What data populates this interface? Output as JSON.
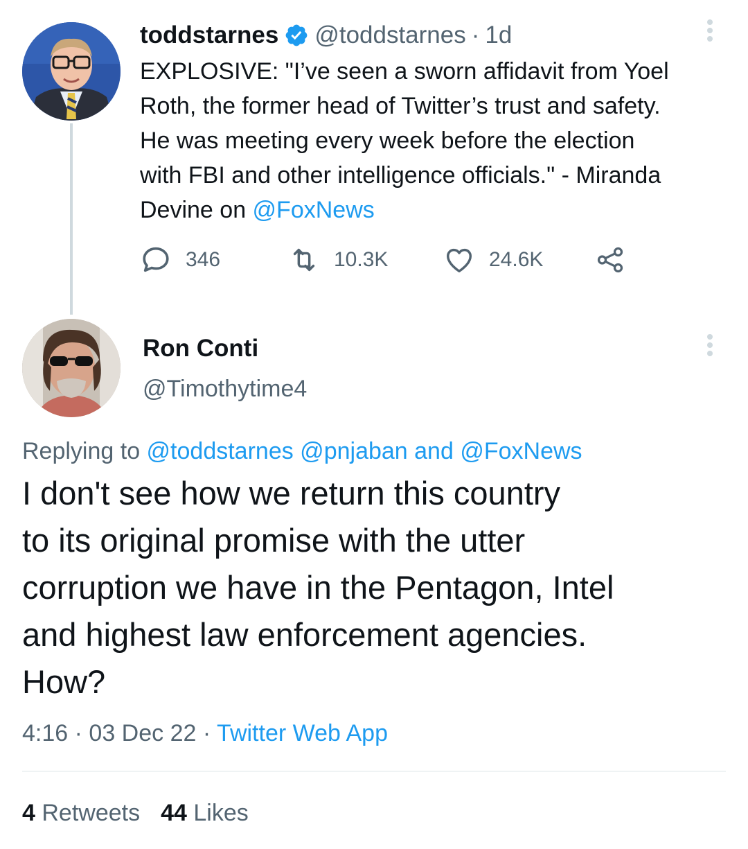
{
  "parent_tweet": {
    "display_name": "toddstarnes",
    "verified_icon": "verified-badge-icon",
    "handle": "@toddstarnes",
    "separator": "·",
    "time": "1d",
    "text_lines": [
      "EXPLOSIVE: \"I’ve seen a sworn affidavit from Yoel",
      "Roth, the former head of Twitter’s trust and safety.",
      "He was meeting every week before the election",
      "with FBI and other intelligence officials.\" - Miranda",
      "Devine on "
    ],
    "text_mention": "@FoxNews",
    "actions": {
      "replies": "346",
      "retweets": "10.3K",
      "likes": "24.6K"
    }
  },
  "reply_tweet": {
    "display_name": "Ron Conti",
    "handle": "@Timothytime4",
    "replying_prefix": "Replying to ",
    "replying_mentions": "@toddstarnes @pnjaban and @FoxNews",
    "text_lines": [
      "I don't see how we return this country",
      "to its original promise with the utter",
      "corruption we have in the Pentagon, Intel",
      "and highest law enforcement agencies.",
      "How?"
    ],
    "time": "4:16",
    "separator": "·",
    "date": "03 Dec 22",
    "source": "Twitter Web App",
    "retweet_count": "4",
    "retweet_label": "Retweets",
    "like_count": "44",
    "like_label": "Likes"
  },
  "colors": {
    "accent": "#1d9bf0",
    "text_primary": "#0f1419",
    "text_secondary": "#536471",
    "thread_line": "#cfd9de"
  }
}
